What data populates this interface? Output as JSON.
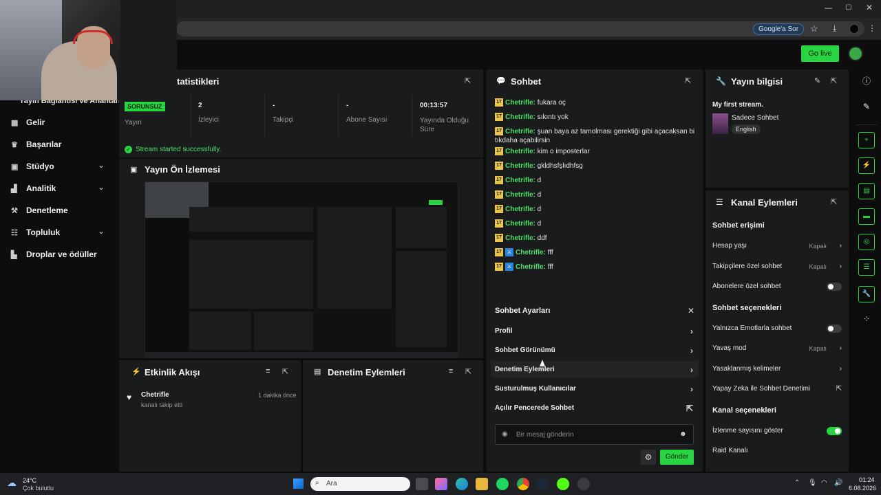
{
  "browser": {
    "google_sor": "Google'a Sor"
  },
  "topbar": {
    "go_live": "Go live"
  },
  "sidebar": {
    "partial_item": "Yayın Bağlantısı ve Anahtarı",
    "items": [
      {
        "label": "Gelir",
        "icon": "money-icon",
        "chevron": false
      },
      {
        "label": "Başarılar",
        "icon": "trophy-icon",
        "chevron": false
      },
      {
        "label": "Stüdyo",
        "icon": "studio-icon",
        "chevron": true
      },
      {
        "label": "Analitik",
        "icon": "analytics-icon",
        "chevron": true
      },
      {
        "label": "Denetleme",
        "icon": "wrench-icon",
        "chevron": false
      },
      {
        "label": "Topluluk",
        "icon": "community-icon",
        "chevron": true
      },
      {
        "label": "Droplar ve ödüller",
        "icon": "gift-icon",
        "chevron": false
      }
    ]
  },
  "stats": {
    "title": "tatistikleri",
    "items": [
      {
        "value": "SORUNSUZ",
        "label": "Yayın"
      },
      {
        "value": "2",
        "label": "İzleyici"
      },
      {
        "value": "-",
        "label": "Takipçi"
      },
      {
        "value": "-",
        "label": "Abone Sayısı"
      },
      {
        "value": "00:13:57",
        "label": "Yayında Olduğu Süre"
      }
    ],
    "success": "Stream started successfully."
  },
  "preview": {
    "title": "Yayın Ön İzlemesi"
  },
  "activity": {
    "title": "Etkinlik Akışı",
    "event_user": "Chetrifle",
    "event_text": "kanalı takip etti",
    "event_time": "1 dakika önce"
  },
  "moderation": {
    "title": "Denetim Eylemleri"
  },
  "chat": {
    "title": "Sohbet",
    "messages": [
      {
        "badge": "17",
        "mod": false,
        "user": "Chetrifle:",
        "text": "fukara oç"
      },
      {
        "badge": "17",
        "mod": false,
        "user": "Chetrifle:",
        "text": "sıkıntı yok"
      },
      {
        "badge": "17",
        "mod": false,
        "user": "Chetrifle:",
        "text": "şuan baya az tamolması gerektiği gibi açacaksan bi",
        "text2": "tıkdaha açabilirsin"
      },
      {
        "badge": "17",
        "mod": false,
        "user": "Chetrifle:",
        "text": "kim o imposterlar"
      },
      {
        "badge": "17",
        "mod": false,
        "user": "Chetrifle:",
        "text": "gkldhsfşlıdhfsg"
      },
      {
        "badge": "17",
        "mod": false,
        "user": "Chetrifle:",
        "text": "d"
      },
      {
        "badge": "17",
        "mod": false,
        "user": "Chetrifle:",
        "text": "d"
      },
      {
        "badge": "17",
        "mod": false,
        "user": "Chetrifle:",
        "text": "d"
      },
      {
        "badge": "17",
        "mod": false,
        "user": "Chetrifle:",
        "text": "d"
      },
      {
        "badge": "17",
        "mod": false,
        "user": "Chetrifle:",
        "text": "ddf"
      },
      {
        "badge": "17",
        "mod": true,
        "user": "Chetrifle:",
        "text": "fff"
      },
      {
        "badge": "17",
        "mod": true,
        "user": "Chetrifle:",
        "text": "fff"
      }
    ],
    "settings_title": "Sohbet Ayarları",
    "settings": [
      "Profil",
      "Sohbet Görünümü",
      "Denetim Eylemleri",
      "Susturulmuş Kullanıcılar",
      "Açılır Pencerede Sohbet"
    ],
    "input_placeholder": "Bir mesaj gönderin",
    "send": "Gönder"
  },
  "stream_info": {
    "title": "Yayın bilgisi",
    "stream_title": "My first stream.",
    "category": "Sadece Sohbet",
    "language": "English"
  },
  "channel_actions": {
    "title": "Kanal Eylemleri",
    "sections": [
      {
        "heading": "Sohbet erişimi",
        "rows": [
          {
            "label": "Hesap yaşı",
            "value": "Kapalı",
            "kind": "arrow"
          },
          {
            "label": "Takipçilere özel sohbet",
            "value": "Kapalı",
            "kind": "arrow"
          },
          {
            "label": "Abonelere özel sohbet",
            "value": "",
            "kind": "toggle-off"
          }
        ]
      },
      {
        "heading": "Sohbet seçenekleri",
        "rows": [
          {
            "label": "Yalnızca Emotlarla sohbet",
            "value": "",
            "kind": "toggle-off"
          },
          {
            "label": "Yavaş mod",
            "value": "Kapalı",
            "kind": "arrow"
          },
          {
            "label": "Yasaklanmış kelimeler",
            "value": "",
            "kind": "arrow"
          },
          {
            "label": "Yapay Zeka ile Sohbet Denetimi",
            "value": "",
            "kind": "external"
          }
        ]
      },
      {
        "heading": "Kanal seçenekleri",
        "rows": [
          {
            "label": "İzlenme sayısını göster",
            "value": "",
            "kind": "toggle-on"
          },
          {
            "label": "Raid Kanalı",
            "value": "",
            "kind": "none"
          }
        ]
      }
    ]
  },
  "taskbar": {
    "temp": "24°C",
    "weather": "Çok bulutlu",
    "search": "Ara",
    "time": "01:24",
    "date": "6.08.2026"
  },
  "colors": {
    "accent": "#29d442",
    "username": "#4fe068",
    "panel": "#1a1b1c"
  }
}
